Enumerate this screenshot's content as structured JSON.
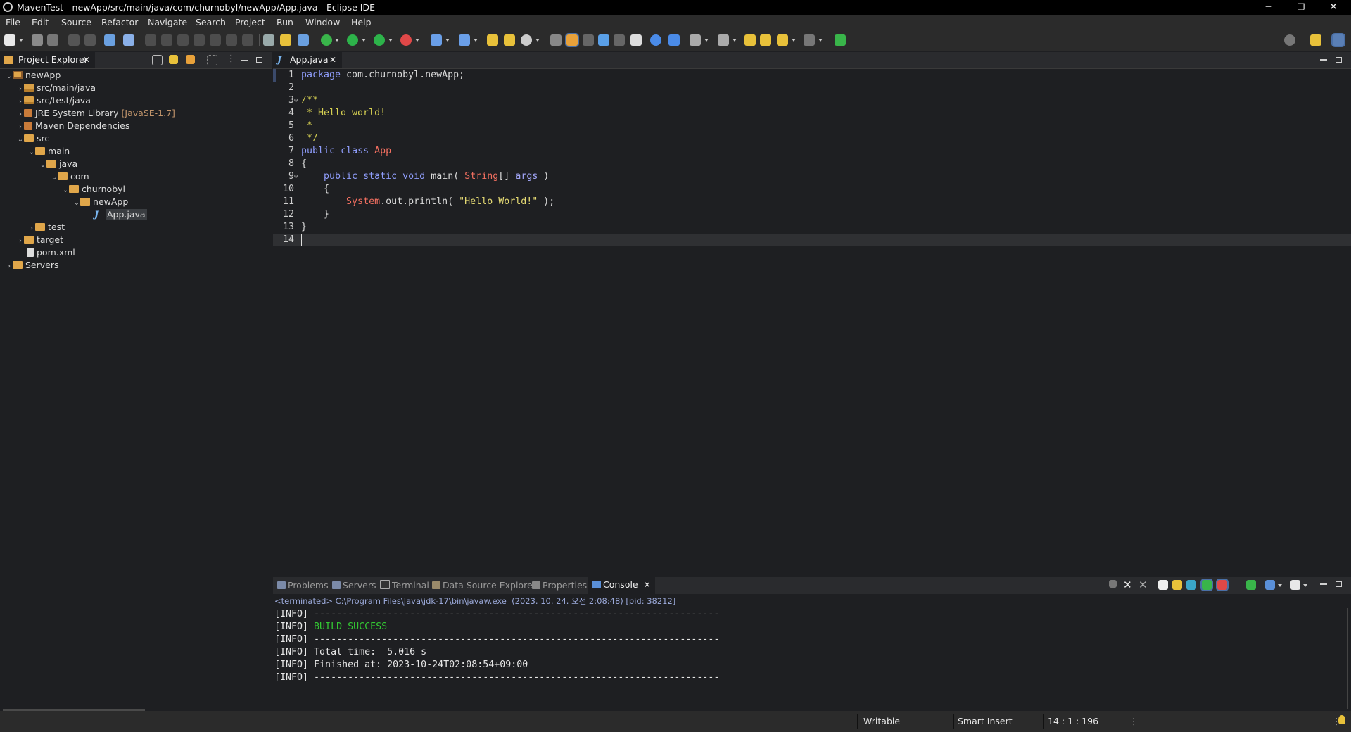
{
  "window": {
    "title": "MavenTest - newApp/src/main/java/com/churnobyl/newApp/App.java - Eclipse IDE",
    "minimize": "─",
    "restore": "❐",
    "close": "✕"
  },
  "menu": [
    "File",
    "Edit",
    "Source",
    "Refactor",
    "Navigate",
    "Search",
    "Project",
    "Run",
    "Window",
    "Help"
  ],
  "explorer": {
    "tab_label": "Project Explorer",
    "tree": [
      {
        "label": "newApp",
        "decoration": "",
        "icon": "project-icon",
        "expanded": true
      },
      {
        "label": "src/main/java",
        "decoration": "",
        "icon": "package-folder-icon",
        "expanded": false
      },
      {
        "label": "src/test/java",
        "decoration": "",
        "icon": "package-folder-icon",
        "expanded": false
      },
      {
        "label": "JRE System Library",
        "decoration": "[JavaSE-1.7]",
        "icon": "library-icon",
        "expanded": false
      },
      {
        "label": "Maven Dependencies",
        "decoration": "",
        "icon": "library-icon",
        "expanded": false
      },
      {
        "label": "src",
        "decoration": "",
        "icon": "folder-icon",
        "expanded": true
      },
      {
        "label": "main",
        "decoration": "",
        "icon": "folder-icon",
        "expanded": true
      },
      {
        "label": "java",
        "decoration": "",
        "icon": "folder-icon",
        "expanded": true
      },
      {
        "label": "com",
        "decoration": "",
        "icon": "folder-icon",
        "expanded": true
      },
      {
        "label": "churnobyl",
        "decoration": "",
        "icon": "folder-icon",
        "expanded": true
      },
      {
        "label": "newApp",
        "decoration": "",
        "icon": "folder-icon",
        "expanded": true
      },
      {
        "label": "App.java",
        "decoration": "",
        "icon": "java-file-icon",
        "selected": true
      },
      {
        "label": "test",
        "decoration": "",
        "icon": "folder-icon",
        "expanded": false
      },
      {
        "label": "target",
        "decoration": "",
        "icon": "folder-icon",
        "expanded": false
      },
      {
        "label": "pom.xml",
        "decoration": "",
        "icon": "xml-file-icon"
      },
      {
        "label": "Servers",
        "decoration": "",
        "icon": "folder-icon",
        "expanded": false
      }
    ]
  },
  "editor": {
    "tab_label": "App.java",
    "lines": [
      {
        "n": "1",
        "text": "package com.churnobyl.newApp;"
      },
      {
        "n": "2",
        "text": ""
      },
      {
        "n": "3",
        "text": "/**"
      },
      {
        "n": "4",
        "text": " * Hello world!"
      },
      {
        "n": "5",
        "text": " *"
      },
      {
        "n": "6",
        "text": " */"
      },
      {
        "n": "7",
        "text": "public class App"
      },
      {
        "n": "8",
        "text": "{"
      },
      {
        "n": "9",
        "text": "    public static void main( String[] args )"
      },
      {
        "n": "10",
        "text": "    {"
      },
      {
        "n": "11",
        "text": "        System.out.println( \"Hello World!\" );"
      },
      {
        "n": "12",
        "text": "    }"
      },
      {
        "n": "13",
        "text": "}"
      },
      {
        "n": "14",
        "text": ""
      }
    ],
    "tokens": {
      "package_kw": "package",
      "package_name": " com.churnobyl.newApp;",
      "c3": "/**",
      "c4": " * Hello world!",
      "c5": " *",
      "c6": " */",
      "public": "public",
      "class": "class",
      "App": "App",
      "brace_open": "{",
      "brace_close": "}",
      "static": "static",
      "void": "void",
      "main": "main(",
      "String": "String",
      "arr": "[] ",
      "args": "args",
      "paren_close": " )",
      "System": "System",
      "out_println": ".out.println( ",
      "hello": "\"Hello World!\"",
      "semi": " );"
    }
  },
  "console": {
    "tabs": [
      "Problems",
      "Servers",
      "Terminal",
      "Data Source Explorer",
      "Properties",
      "Console"
    ],
    "header": "<terminated> C:\\Program Files\\Java\\jdk-17\\bin\\javaw.exe  (2023. 10. 24. 오전 2:08:48) [pid: 38212]",
    "lines": [
      {
        "prefix": "[INFO] ",
        "text": "------------------------------------------------------------------------"
      },
      {
        "prefix": "[INFO] ",
        "text": "BUILD SUCCESS",
        "success": true
      },
      {
        "prefix": "[INFO] ",
        "text": "------------------------------------------------------------------------"
      },
      {
        "prefix": "[INFO] ",
        "text": "Total time:  5.016 s"
      },
      {
        "prefix": "[INFO] ",
        "text": "Finished at: 2023-10-24T02:08:54+09:00"
      },
      {
        "prefix": "[INFO] ",
        "text": "------------------------------------------------------------------------"
      }
    ]
  },
  "status": {
    "writable": "Writable",
    "insert_mode": "Smart Insert",
    "position": "14 : 1 : 196"
  },
  "colors": {
    "success": "#33c733",
    "keyword": "#8f9dfb",
    "type": "#f26f60",
    "comment": "#d6d052"
  }
}
